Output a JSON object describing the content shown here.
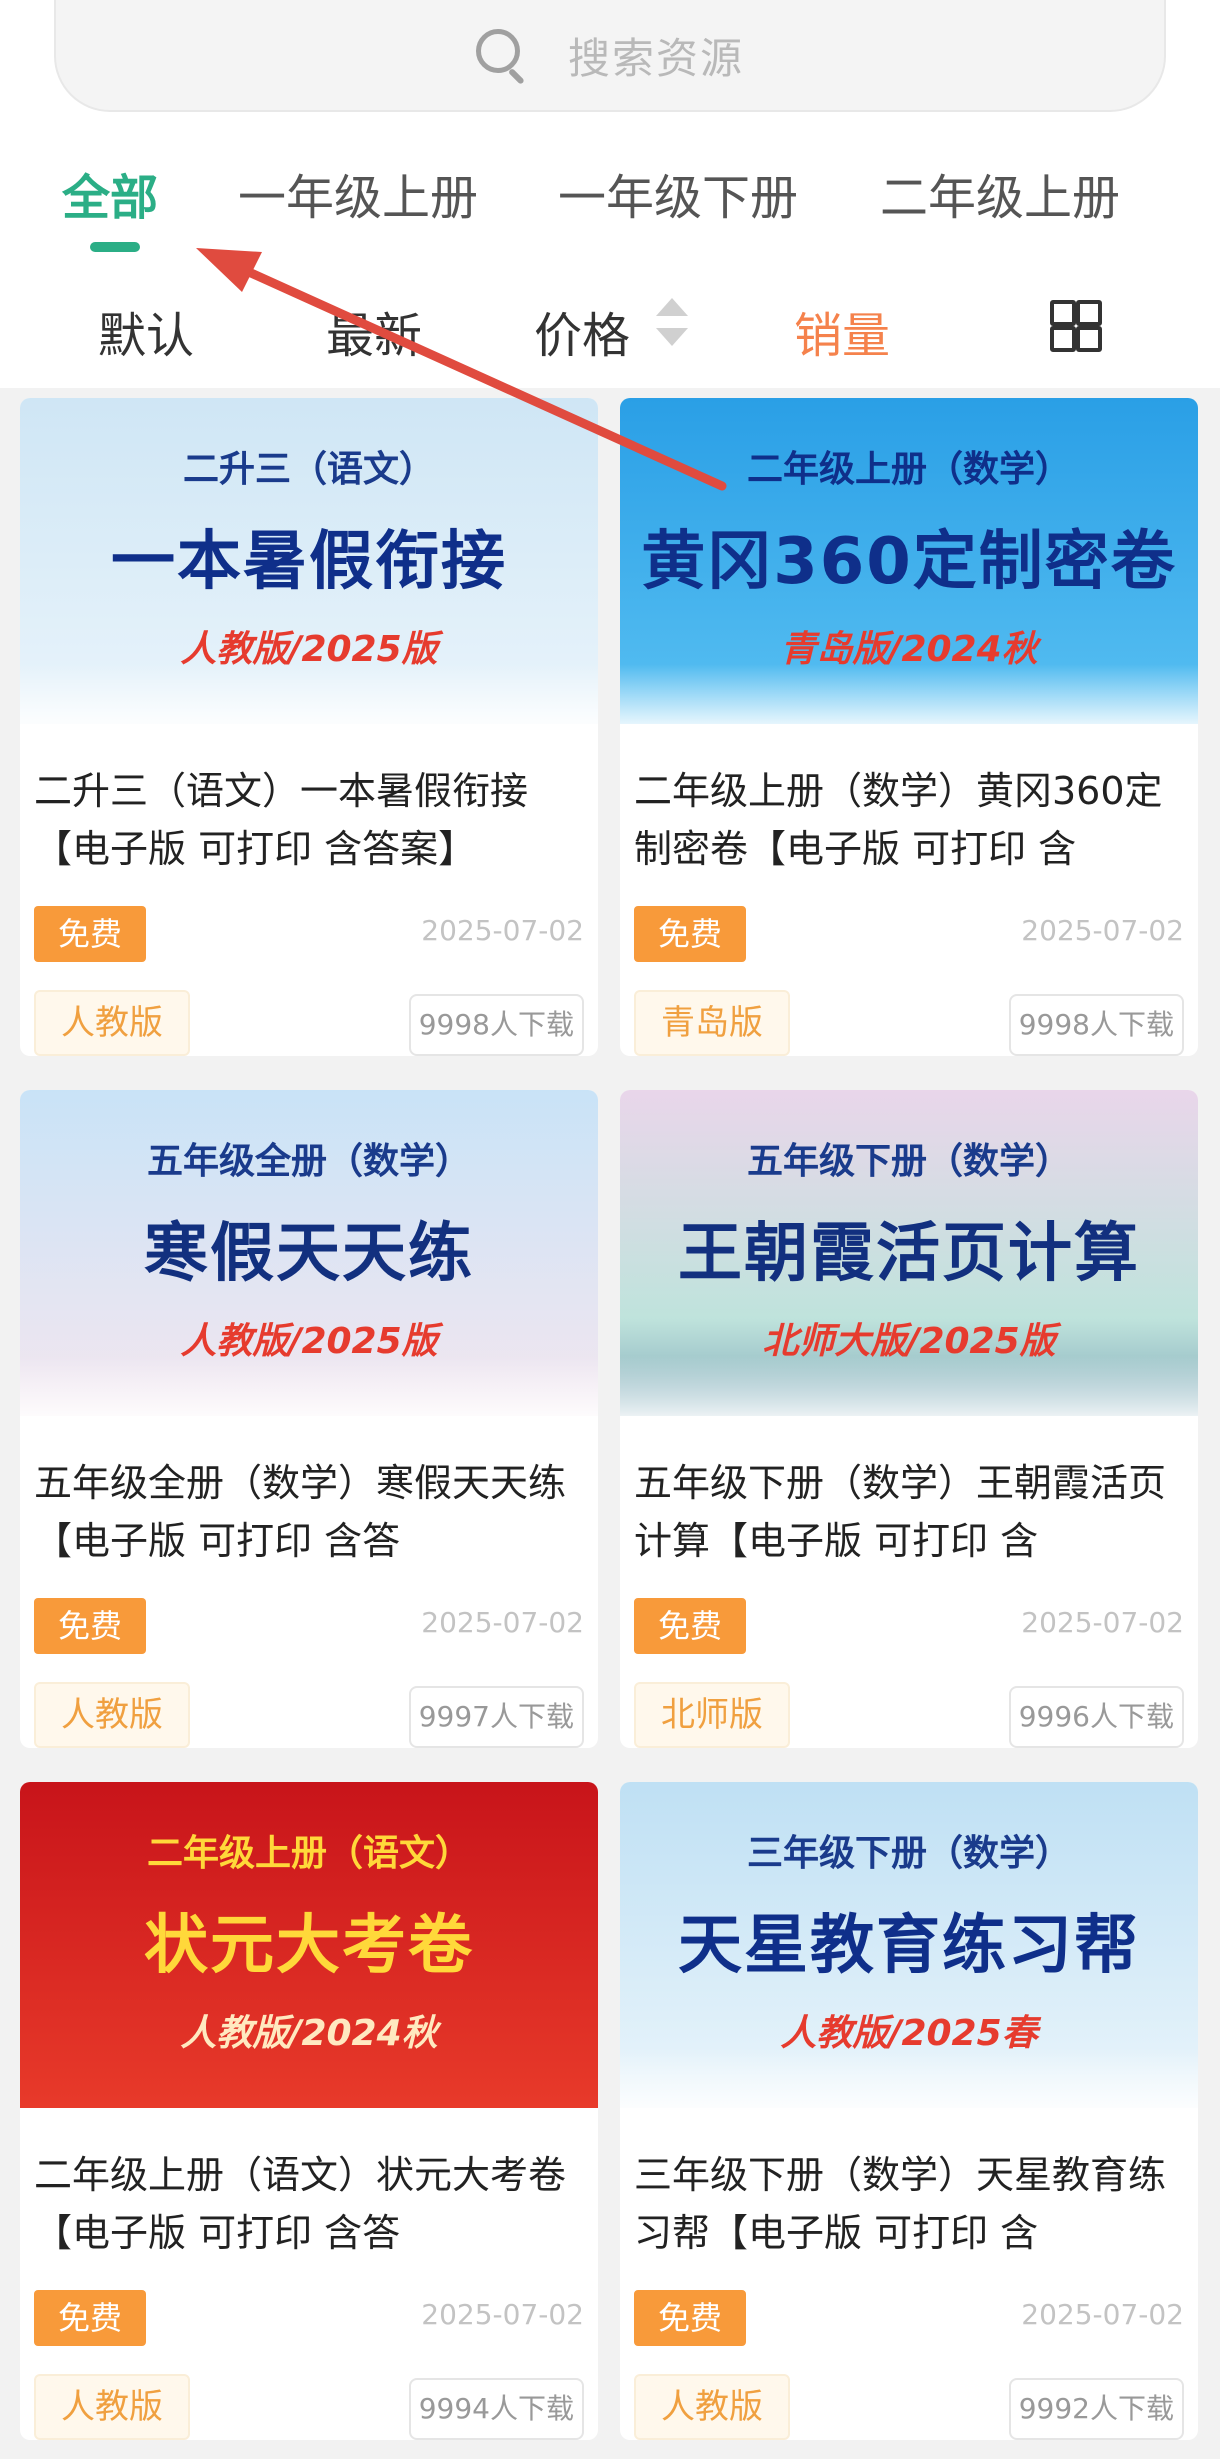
{
  "search": {
    "placeholder": "搜索资源"
  },
  "grades": [
    {
      "label": "全部",
      "active": true
    },
    {
      "label": "一年级上册",
      "active": false
    },
    {
      "label": "一年级下册",
      "active": false
    },
    {
      "label": "二年级上册",
      "active": false
    }
  ],
  "sort": {
    "default_label": "默认",
    "newest_label": "最新",
    "price_label": "价格",
    "sales_label": "销量",
    "view_toggle_icon": "grid-view-icon"
  },
  "colors": {
    "accent": "#2bae86",
    "sales": "#f5824c",
    "free_tag": "#f89a3a",
    "annotation_arrow": "#e04b3f"
  },
  "cards": [
    {
      "banner": {
        "subtitle": "二升三（语文）",
        "main": "一本暑假衔接",
        "edition": "人教版/2025版",
        "bg": "#cfe6f5",
        "main_color": "#0f2f8a",
        "sub_color": "#1a3b8c"
      },
      "title": "二升三（语文）一本暑假衔接【电子版 可打印 含答案】",
      "price": "免费",
      "date": "2025-07-02",
      "edition": "人教版",
      "downloads": "9998人下载"
    },
    {
      "banner": {
        "subtitle": "二年级上册（数学）",
        "main": "黄冈360定制密卷",
        "edition": "青岛版/2024秋",
        "bg": "#2a9fe6",
        "main_color": "#0f2f8a",
        "sub_color": "#0f2f8a"
      },
      "title": "二年级上册（数学）黄冈360定制密卷【电子版 可打印 含",
      "price": "免费",
      "date": "2025-07-02",
      "edition": "青岛版",
      "downloads": "9998人下载"
    },
    {
      "banner": {
        "subtitle": "五年级全册（数学）",
        "main": "寒假天天练",
        "edition": "人教版/2025版",
        "bg": "#c9e3f7",
        "main_color": "#12307f",
        "sub_color": "#1a3b8c"
      },
      "title": "五年级全册（数学）寒假天天练【电子版 可打印 含答",
      "price": "免费",
      "date": "2025-07-02",
      "edition": "人教版",
      "downloads": "9997人下载"
    },
    {
      "banner": {
        "subtitle": "五年级下册（数学）",
        "main": "王朝霞活页计算",
        "edition": "北师大版/2025版",
        "bg": "#d6d0ea",
        "main_color": "#12307f",
        "sub_color": "#1a3b8c"
      },
      "title": "五年级下册（数学）王朝霞活页计算【电子版 可打印 含",
      "price": "免费",
      "date": "2025-07-02",
      "edition": "北师版",
      "downloads": "9996人下载"
    },
    {
      "banner": {
        "subtitle": "二年级上册（语文）",
        "main": "状元大考卷",
        "edition": "人教版/2024秋",
        "bg": "#d9201c",
        "main_color": "#ffd83a",
        "sub_color": "#ffd83a"
      },
      "title": "二年级上册（语文）状元大考卷【电子版 可打印 含答",
      "price": "免费",
      "date": "2025-07-02",
      "edition": "人教版",
      "downloads": "9994人下载"
    },
    {
      "banner": {
        "subtitle": "三年级下册（数学）",
        "main": "天星教育练习帮",
        "edition": "人教版/2025春",
        "bg": "#bfe0f4",
        "main_color": "#0f2f8a",
        "sub_color": "#1a3b8c"
      },
      "title": "三年级下册（数学）天星教育练习帮【电子版 可打印 含",
      "price": "免费",
      "date": "2025-07-02",
      "edition": "人教版",
      "downloads": "9992人下载"
    }
  ]
}
